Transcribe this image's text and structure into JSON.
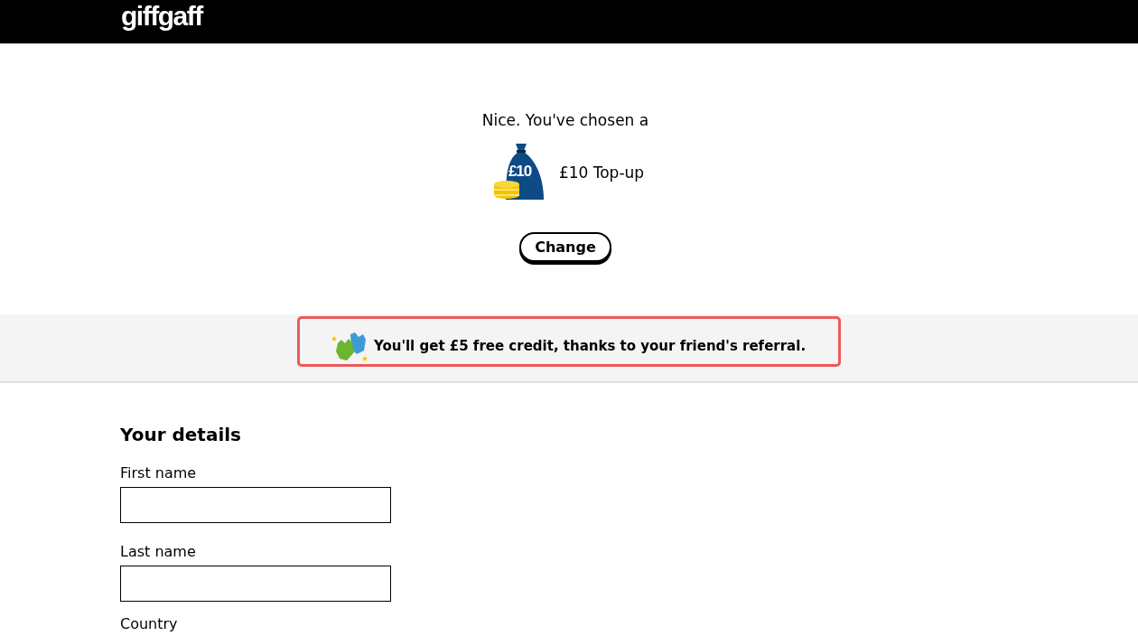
{
  "header": {
    "logo": "giffgaff"
  },
  "choice": {
    "intro": "Nice. You've chosen a",
    "bag_amount": "£10",
    "product": "£10 Top-up",
    "change_button": "Change"
  },
  "referral": {
    "message": "You'll get £5 free credit, thanks to your friend's referral."
  },
  "details": {
    "heading": "Your details",
    "fields": [
      {
        "label": "First name"
      },
      {
        "label": "Last name"
      }
    ],
    "next_label": "Country"
  }
}
